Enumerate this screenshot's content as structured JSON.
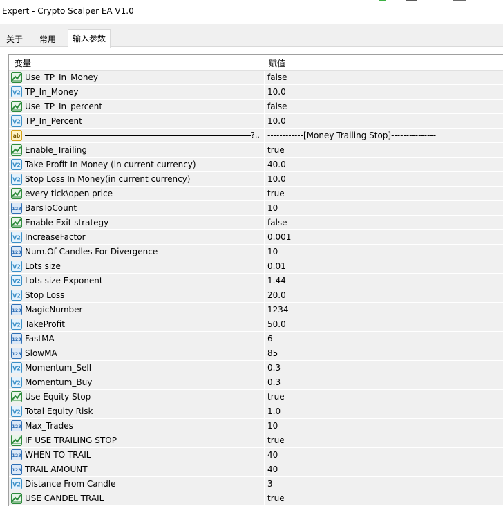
{
  "window": {
    "title": "Expert - Crypto Scalper EA V1.0"
  },
  "tabs": [
    {
      "label": "关于",
      "active": false
    },
    {
      "label": "常用",
      "active": false
    },
    {
      "label": "输入参数",
      "active": true
    }
  ],
  "table": {
    "headers": {
      "variable": "变量",
      "value": "赋值"
    },
    "rows": [
      {
        "type": "bool",
        "name": "Use_TP_In_Money",
        "value": "false"
      },
      {
        "type": "double",
        "name": "TP_In_Money",
        "value": "10.0"
      },
      {
        "type": "bool",
        "name": "Use_TP_In_percent",
        "value": "false"
      },
      {
        "type": "double",
        "name": "TP_In_Percent",
        "value": "10.0"
      },
      {
        "type": "string",
        "name": "",
        "suffix": "?..",
        "value": "------------[Money Trailing Stop]---------------"
      },
      {
        "type": "bool",
        "name": "Enable_Trailing",
        "value": "true"
      },
      {
        "type": "double",
        "name": "Take Profit In Money (in current currency)",
        "value": "40.0"
      },
      {
        "type": "double",
        "name": "Stop Loss In Money(in current currency)",
        "value": "10.0"
      },
      {
        "type": "bool",
        "name": "every tick\\open price",
        "value": "true"
      },
      {
        "type": "int",
        "name": "BarsToCount",
        "value": "10"
      },
      {
        "type": "bool",
        "name": "Enable Exit strategy",
        "value": "false"
      },
      {
        "type": "double",
        "name": "IncreaseFactor",
        "value": "0.001"
      },
      {
        "type": "int",
        "name": "Num.Of Candles For Divergence",
        "value": "10"
      },
      {
        "type": "double",
        "name": "Lots size",
        "value": "0.01"
      },
      {
        "type": "double",
        "name": "Lots size Exponent",
        "value": "1.44"
      },
      {
        "type": "double",
        "name": "Stop Loss",
        "value": "20.0"
      },
      {
        "type": "int",
        "name": "MagicNumber",
        "value": "1234"
      },
      {
        "type": "double",
        "name": "TakeProfit",
        "value": "50.0"
      },
      {
        "type": "int",
        "name": "FastMA",
        "value": "6"
      },
      {
        "type": "int",
        "name": "SlowMA",
        "value": "85"
      },
      {
        "type": "double",
        "name": "Momentum_Sell",
        "value": "0.3"
      },
      {
        "type": "double",
        "name": "Momentum_Buy",
        "value": "0.3"
      },
      {
        "type": "bool",
        "name": "Use Equity Stop",
        "value": "true"
      },
      {
        "type": "double",
        "name": "Total Equity Risk",
        "value": "1.0"
      },
      {
        "type": "int",
        "name": "Max_Trades",
        "value": "10"
      },
      {
        "type": "bool",
        "name": "IF USE TRAILING STOP",
        "value": "true"
      },
      {
        "type": "int",
        "name": "WHEN TO TRAIL",
        "value": "40"
      },
      {
        "type": "int",
        "name": "TRAIL AMOUNT",
        "value": "40"
      },
      {
        "type": "double",
        "name": "Distance From Candle",
        "value": "3"
      },
      {
        "type": "bool",
        "name": "USE CANDEL TRAIL",
        "value": "true"
      }
    ]
  },
  "icons": {
    "bool": "bool-chart-icon",
    "double": "double-v2-icon",
    "int": "int-123-icon",
    "string": "string-ab-icon"
  },
  "colors": {
    "row_bg": "#f0f0f0",
    "panel_bg": "#ffffff",
    "bool_icon": "#2e8b3c",
    "double_icon": "#3a8fc7",
    "int_icon": "#2f6fb5",
    "string_icon": "#d4a017"
  }
}
